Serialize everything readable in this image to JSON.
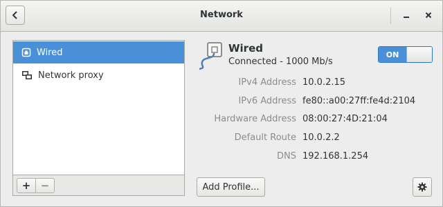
{
  "window": {
    "title": "Network"
  },
  "devices": [
    {
      "label": "Wired",
      "icon": "wired-ethernet-icon",
      "selected": true
    },
    {
      "label": "Network proxy",
      "icon": "network-proxy-icon",
      "selected": false
    }
  ],
  "list_toolbar": {
    "add_label": "+",
    "remove_label": "−"
  },
  "detail": {
    "name": "Wired",
    "status": "Connected - 1000 Mb/s",
    "toggle_label": "ON",
    "properties": [
      {
        "label": "IPv4 Address",
        "value": "10.0.2.15"
      },
      {
        "label": "IPv6 Address",
        "value": "fe80::a00:27ff:fe4d:2104"
      },
      {
        "label": "Hardware Address",
        "value": "08:00:27:4D:21:04"
      },
      {
        "label": "Default Route",
        "value": "10.0.2.2"
      },
      {
        "label": "DNS",
        "value": "192.168.1.254"
      }
    ],
    "add_profile_label": "Add Profile..."
  },
  "colors": {
    "accent": "#4a90d9",
    "label_gray": "#8a8d89"
  }
}
